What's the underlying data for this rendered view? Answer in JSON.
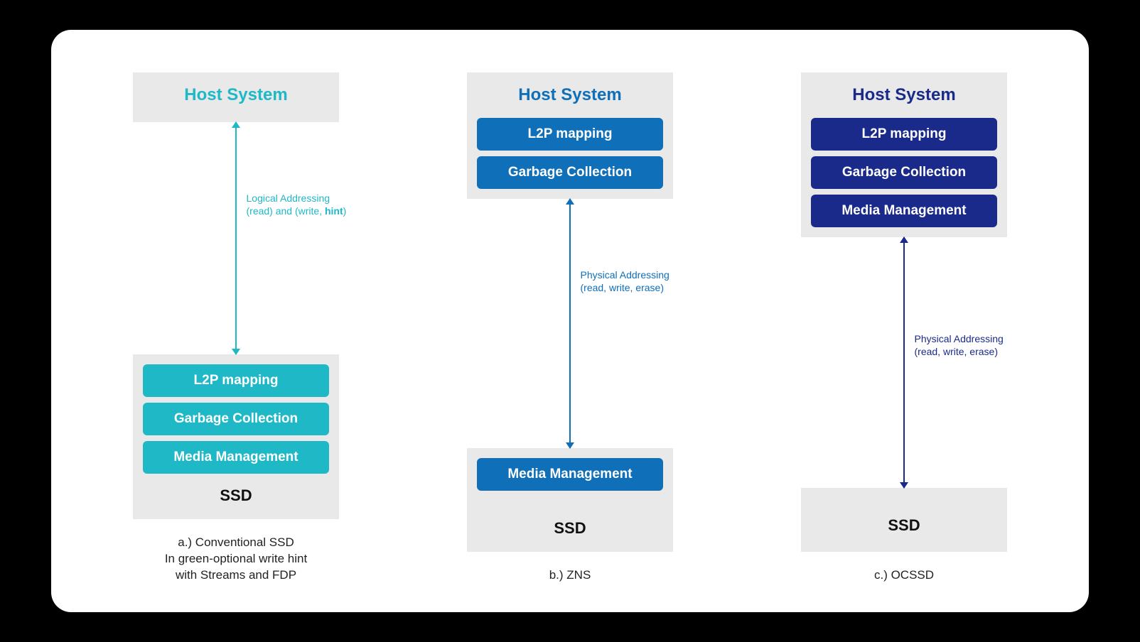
{
  "columns": {
    "a": {
      "host_title": "Host System",
      "arrow_line1": "Logical Addressing",
      "arrow_line2_pre": "(read) and (write, ",
      "arrow_line2_bold": "hint",
      "arrow_line2_post": ")",
      "ssd_pills": {
        "p1": "L2P mapping",
        "p2": "Garbage Collection",
        "p3": "Media Management"
      },
      "ssd_label": "SSD",
      "caption_l1": "a.) Conventional SSD",
      "caption_l2": "In green-optional write hint",
      "caption_l3": "with Streams and FDP"
    },
    "b": {
      "host_title": "Host System",
      "host_pills": {
        "p1": "L2P mapping",
        "p2": "Garbage Collection"
      },
      "arrow_line1": "Physical Addressing",
      "arrow_line2": "(read, write, erase)",
      "ssd_pills": {
        "p1": "Media Management"
      },
      "ssd_label": "SSD",
      "caption": "b.) ZNS"
    },
    "c": {
      "host_title": "Host System",
      "host_pills": {
        "p1": "L2P mapping",
        "p2": "Garbage Collection",
        "p3": "Media Management"
      },
      "arrow_line1": "Physical Addressing",
      "arrow_line2": "(read, write, erase)",
      "ssd_label": "SSD",
      "caption": "c.) OCSSD"
    }
  }
}
